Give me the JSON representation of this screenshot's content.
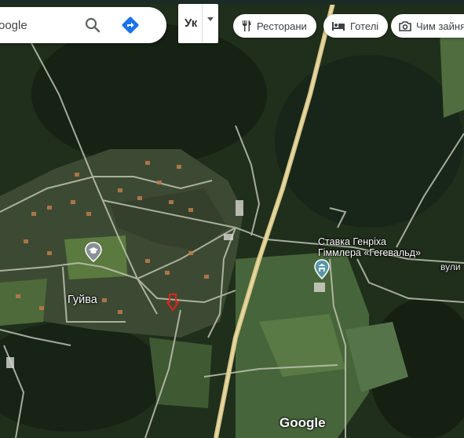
{
  "search": {
    "text": "oogle"
  },
  "language": {
    "label": "Ук"
  },
  "chips": [
    {
      "label": "Ресторани",
      "icon": "restaurant-icon"
    },
    {
      "label": "Готелі",
      "icon": "hotel-icon"
    },
    {
      "label": "Чим зайня",
      "icon": "camera-icon"
    }
  ],
  "map": {
    "poi": {
      "line1": "Ставка Генріха",
      "line2": "Гіммлера «Гегевальд»",
      "icon": "museum-pin-icon"
    },
    "village": "Гуйва",
    "street": "вули",
    "school_icon": "school-pin-icon",
    "marker_icon": "red-arrow-marker-icon",
    "colors": {
      "forest": "#1c2a18",
      "field": "#4c6a38",
      "road": "#c9cbb8",
      "highway": "#d8c98a",
      "poi_pin": "#5a97a8"
    }
  },
  "attribution": "Google"
}
